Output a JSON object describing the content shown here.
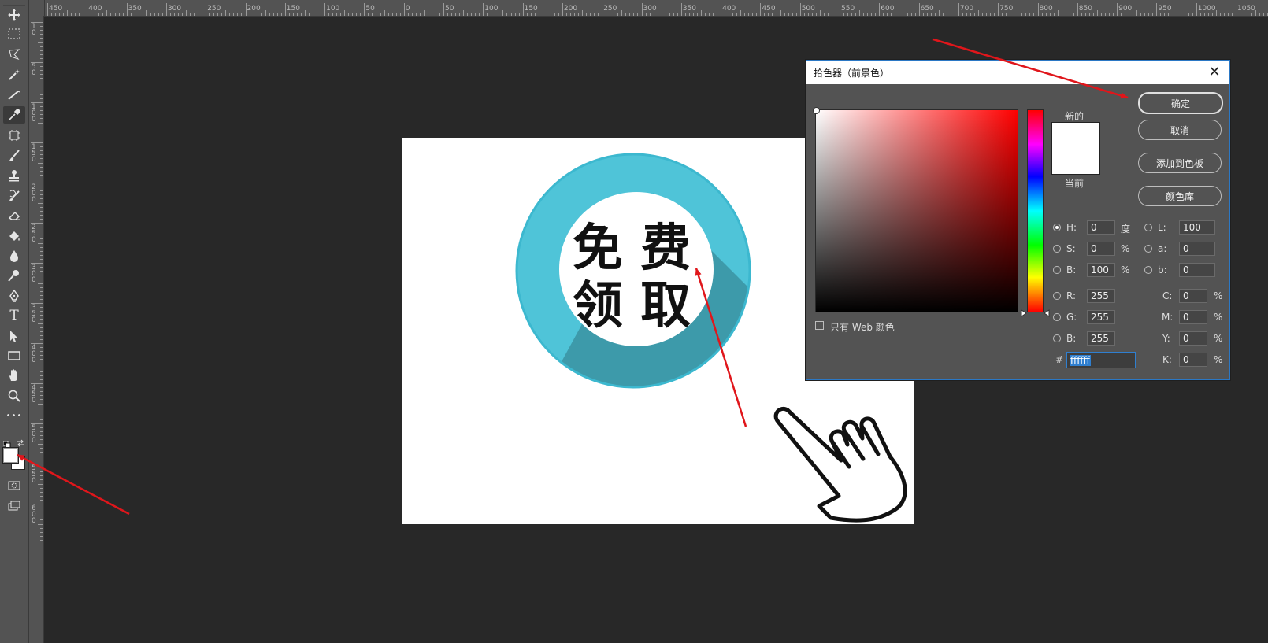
{
  "ruler_top_labels": [
    "450",
    "400",
    "350",
    "300",
    "250",
    "200",
    "150",
    "100",
    "50",
    "0",
    "50",
    "100",
    "150",
    "200",
    "250",
    "300",
    "350",
    "400",
    "450",
    "500",
    "550",
    "600",
    "650",
    "700",
    "750",
    "800",
    "850",
    "900",
    "950",
    "1000",
    "1050"
  ],
  "ruler_left_labels": [
    "1\n0",
    "5\n0",
    "1\n0\n0",
    "1\n5\n0",
    "2\n0\n0",
    "2\n5\n0",
    "3\n0\n0",
    "3\n5\n0",
    "4\n0\n0",
    "4\n5\n0",
    "5\n0\n0",
    "5\n5\n0",
    "6\n0\n0"
  ],
  "toolbar": {
    "tools": [
      "move-tool",
      "marquee-tool",
      "lasso-tool",
      "magic-wand-tool",
      "pen-ruler-tool",
      "eyedropper-tool",
      "frame-tool",
      "brush-tool",
      "stamp-tool",
      "history-brush-tool",
      "eraser-tool",
      "paint-bucket-tool",
      "blur-tool",
      "dodge-tool",
      "pen-tool",
      "type-tool",
      "path-select-tool",
      "rectangle-tool",
      "hand-tool",
      "zoom-tool",
      "more-tool",
      "swap-colors",
      "foreground-color",
      "quick-mask",
      "screen-mode"
    ],
    "type_glyph": "T",
    "more_glyph": "•••"
  },
  "canvas": {
    "text_line1": "免 费",
    "text_line2": "领 取",
    "circle_color": "#50c3d6",
    "shadow_color": "#3b98a8"
  },
  "dialog": {
    "title": "拾色器（前景色）",
    "close": "✕",
    "buttons": {
      "ok": "确定",
      "cancel": "取消",
      "add_swatch": "添加到色板",
      "libraries": "颜色库"
    },
    "new_label": "新的",
    "current_label": "当前",
    "new_color": "#ffffff",
    "current_color": "#ffffff",
    "web_only_label": "只有 Web 颜色",
    "hsb": {
      "h_label": "H:",
      "h_value": "0",
      "h_unit": "度",
      "s_label": "S:",
      "s_value": "0",
      "s_unit": "%",
      "b_label": "B:",
      "b_value": "100",
      "b_unit": "%"
    },
    "lab": {
      "l_label": "L:",
      "l_value": "100",
      "a_label": "a:",
      "a_value": "0",
      "b_label": "b:",
      "b_value": "0"
    },
    "rgb": {
      "r_label": "R:",
      "r_value": "255",
      "g_label": "G:",
      "g_value": "255",
      "b_label": "B:",
      "b_value": "255"
    },
    "cmyk": {
      "c_label": "C:",
      "c_value": "0",
      "c_unit": "%",
      "m_label": "M:",
      "m_value": "0",
      "m_unit": "%",
      "y_label": "Y:",
      "y_value": "0",
      "y_unit": "%",
      "k_label": "K:",
      "k_value": "0",
      "k_unit": "%"
    },
    "hex_label": "#",
    "hex_value": "ffffff"
  },
  "annotation_color": "#e0161b"
}
